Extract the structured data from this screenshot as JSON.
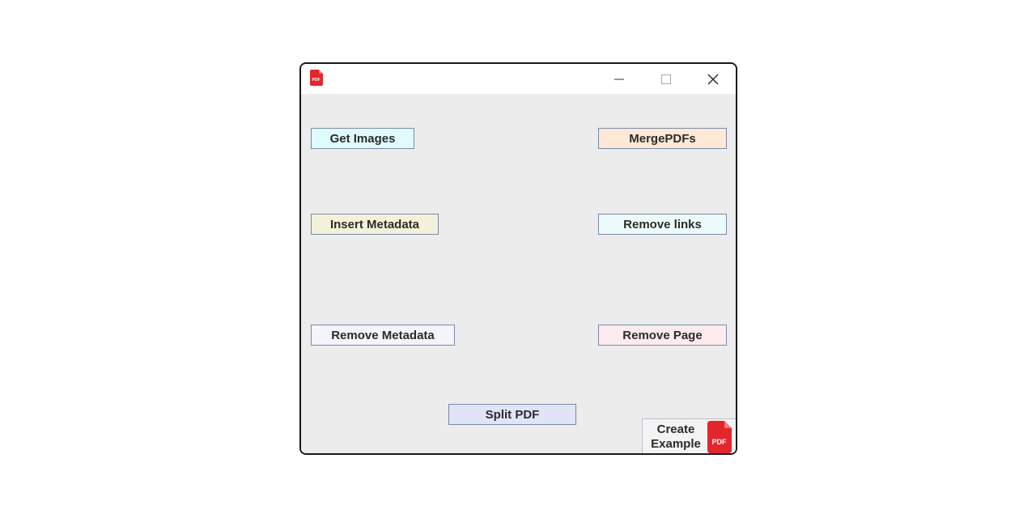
{
  "window": {
    "icon": "pdf-file-icon",
    "controls": {
      "minimize": "minimize-icon",
      "maximize": "maximize-icon",
      "close": "close-icon"
    }
  },
  "buttons": {
    "get_images": "Get Images",
    "merge_pdfs": "MergePDFs",
    "insert_metadata": "Insert Metadata",
    "remove_links": "Remove links",
    "remove_metadata": "Remove Metadata",
    "remove_page": "Remove Page",
    "split_pdf": "Split PDF",
    "create_example_line1": "Create",
    "create_example_line2": "Example"
  },
  "pdf_badge_text": "PDF",
  "colors": {
    "get_images": "#dffbfd",
    "merge_pdfs": "#fde9d5",
    "insert_metadata": "#f4f1da",
    "remove_links": "#eefbfb",
    "remove_metadata": "#f4f4fb",
    "remove_page": "#fdebee",
    "split_pdf": "#e1e4f7",
    "pdf_red": "#e3262b"
  }
}
